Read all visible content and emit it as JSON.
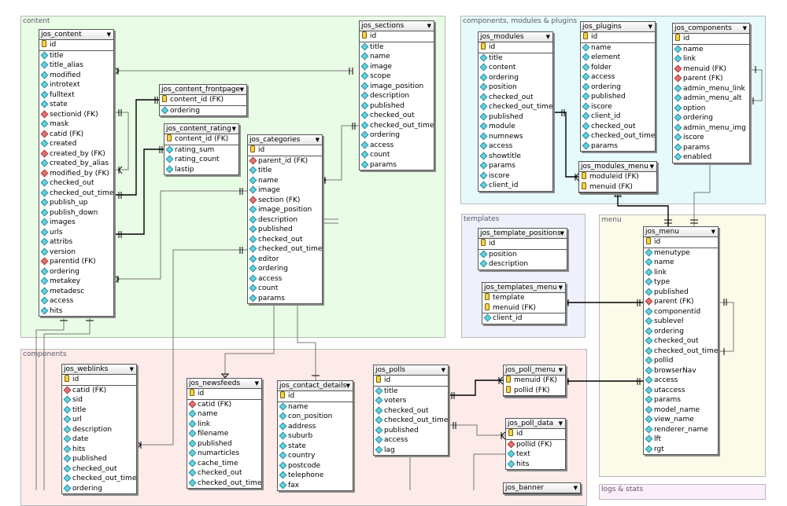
{
  "groups": [
    {
      "id": "content",
      "label": "content",
      "color": "#e9fce6"
    },
    {
      "id": "cmp",
      "label": "components, modules & plugins",
      "color": "#e6fafc"
    },
    {
      "id": "templates",
      "label": "templates",
      "color": "#eef0fc"
    },
    {
      "id": "menu",
      "label": "menu",
      "color": "#fcfbe9"
    },
    {
      "id": "components",
      "label": "components",
      "color": "#fdebea"
    },
    {
      "id": "logs",
      "label": "logs & stats",
      "color": "#fdeefc"
    }
  ],
  "tables": [
    {
      "id": "jos_content",
      "name": "jos_content",
      "fields": [
        [
          "id",
          "pk"
        ],
        [
          "title",
          "col"
        ],
        [
          "title_alias",
          "col"
        ],
        [
          "modified",
          "col"
        ],
        [
          "introtext",
          "col"
        ],
        [
          "fulltext",
          "col"
        ],
        [
          "state",
          "col"
        ],
        [
          "sectionid (FK)",
          "fk"
        ],
        [
          "mask",
          "col"
        ],
        [
          "catid (FK)",
          "fk"
        ],
        [
          "created",
          "col"
        ],
        [
          "created_by (FK)",
          "fk"
        ],
        [
          "created_by_alias",
          "col"
        ],
        [
          "modified_by (FK)",
          "fk"
        ],
        [
          "checked_out",
          "col"
        ],
        [
          "checked_out_time",
          "col"
        ],
        [
          "publish_up",
          "col"
        ],
        [
          "publish_down",
          "col"
        ],
        [
          "images",
          "col"
        ],
        [
          "urls",
          "col"
        ],
        [
          "attribs",
          "col"
        ],
        [
          "version",
          "col"
        ],
        [
          "parentid (FK)",
          "fk"
        ],
        [
          "ordering",
          "col"
        ],
        [
          "metakey",
          "col"
        ],
        [
          "metadesc",
          "col"
        ],
        [
          "access",
          "col"
        ],
        [
          "hits",
          "col"
        ]
      ]
    },
    {
      "id": "jos_content_frontpage",
      "name": "jos_content_frontpage",
      "fields": [
        [
          "content_id (FK)",
          "pk"
        ],
        [
          "ordering",
          "col"
        ]
      ]
    },
    {
      "id": "jos_content_rating",
      "name": "jos_content_rating",
      "fields": [
        [
          "content_id (FK)",
          "pk"
        ],
        [
          "rating_sum",
          "col"
        ],
        [
          "rating_count",
          "col"
        ],
        [
          "lastip",
          "col"
        ]
      ]
    },
    {
      "id": "jos_categories",
      "name": "jos_categories",
      "fields": [
        [
          "id",
          "pk"
        ],
        [
          "parent_id (FK)",
          "fk"
        ],
        [
          "title",
          "col"
        ],
        [
          "name",
          "col"
        ],
        [
          "image",
          "col"
        ],
        [
          "section (FK)",
          "fk"
        ],
        [
          "image_position",
          "col"
        ],
        [
          "description",
          "col"
        ],
        [
          "published",
          "col"
        ],
        [
          "checked_out",
          "col"
        ],
        [
          "checked_out_time",
          "col"
        ],
        [
          "editor",
          "col"
        ],
        [
          "ordering",
          "col"
        ],
        [
          "access",
          "col"
        ],
        [
          "count",
          "col"
        ],
        [
          "params",
          "col"
        ]
      ]
    },
    {
      "id": "jos_sections",
      "name": "jos_sections",
      "fields": [
        [
          "id",
          "pk"
        ],
        [
          "title",
          "col"
        ],
        [
          "name",
          "col"
        ],
        [
          "image",
          "col"
        ],
        [
          "scope",
          "col"
        ],
        [
          "image_position",
          "col"
        ],
        [
          "description",
          "col"
        ],
        [
          "published",
          "col"
        ],
        [
          "checked_out",
          "col"
        ],
        [
          "checked_out_time",
          "col"
        ],
        [
          "ordering",
          "col"
        ],
        [
          "access",
          "col"
        ],
        [
          "count",
          "col"
        ],
        [
          "params",
          "col"
        ]
      ]
    },
    {
      "id": "jos_modules",
      "name": "jos_modules",
      "fields": [
        [
          "id",
          "pk"
        ],
        [
          "title",
          "col"
        ],
        [
          "content",
          "col"
        ],
        [
          "ordering",
          "col"
        ],
        [
          "position",
          "col"
        ],
        [
          "checked_out",
          "col"
        ],
        [
          "checked_out_time",
          "col"
        ],
        [
          "published",
          "col"
        ],
        [
          "module",
          "col"
        ],
        [
          "numnews",
          "col"
        ],
        [
          "access",
          "col"
        ],
        [
          "showtitle",
          "col"
        ],
        [
          "params",
          "col"
        ],
        [
          "iscore",
          "col"
        ],
        [
          "client_id",
          "col"
        ]
      ]
    },
    {
      "id": "jos_plugins",
      "name": "jos_plugins",
      "fields": [
        [
          "id",
          "pk"
        ],
        [
          "name",
          "col"
        ],
        [
          "element",
          "col"
        ],
        [
          "folder",
          "col"
        ],
        [
          "access",
          "col"
        ],
        [
          "ordering",
          "col"
        ],
        [
          "published",
          "col"
        ],
        [
          "iscore",
          "col"
        ],
        [
          "client_id",
          "col"
        ],
        [
          "checked_out",
          "col"
        ],
        [
          "checked_out_time",
          "col"
        ],
        [
          "params",
          "col"
        ]
      ]
    },
    {
      "id": "jos_modules_menu",
      "name": "jos_modules_menu",
      "fields": [
        [
          "moduleid (FK)",
          "pk"
        ],
        [
          "menuid (FK)",
          "pk"
        ]
      ]
    },
    {
      "id": "jos_components",
      "name": "jos_components",
      "fields": [
        [
          "id",
          "pk"
        ],
        [
          "name",
          "col"
        ],
        [
          "link",
          "col"
        ],
        [
          "menuid (FK)",
          "fk"
        ],
        [
          "parent (FK)",
          "fk"
        ],
        [
          "admin_menu_link",
          "col"
        ],
        [
          "admin_menu_alt",
          "col"
        ],
        [
          "option",
          "col"
        ],
        [
          "ordering",
          "col"
        ],
        [
          "admin_menu_img",
          "col"
        ],
        [
          "iscore",
          "col"
        ],
        [
          "params",
          "col"
        ],
        [
          "enabled",
          "col"
        ]
      ]
    },
    {
      "id": "jos_template_positions",
      "name": "jos_template_positions",
      "fields": [
        [
          "id",
          "pk"
        ],
        [
          "position",
          "col"
        ],
        [
          "description",
          "col"
        ]
      ]
    },
    {
      "id": "jos_templates_menu",
      "name": "jos_templates_menu",
      "fields": [
        [
          "template",
          "pk"
        ],
        [
          "menuid (FK)",
          "pk"
        ],
        [
          "client_id",
          "col"
        ]
      ]
    },
    {
      "id": "jos_menu",
      "name": "jos_menu",
      "fields": [
        [
          "id",
          "pk"
        ],
        [
          "menutype",
          "col"
        ],
        [
          "name",
          "col"
        ],
        [
          "link",
          "col"
        ],
        [
          "type",
          "col"
        ],
        [
          "published",
          "col"
        ],
        [
          "parent (FK)",
          "fk"
        ],
        [
          "componentid",
          "col"
        ],
        [
          "sublevel",
          "col"
        ],
        [
          "ordering",
          "col"
        ],
        [
          "checked_out",
          "col"
        ],
        [
          "checked_out_time",
          "col"
        ],
        [
          "pollid",
          "col"
        ],
        [
          "browserNav",
          "col"
        ],
        [
          "access",
          "col"
        ],
        [
          "utaccess",
          "col"
        ],
        [
          "params",
          "col"
        ],
        [
          "model_name",
          "col"
        ],
        [
          "view_name",
          "col"
        ],
        [
          "renderer_name",
          "col"
        ],
        [
          "lft",
          "col"
        ],
        [
          "rgt",
          "col"
        ]
      ]
    },
    {
      "id": "jos_weblinks",
      "name": "jos_weblinks",
      "fields": [
        [
          "id",
          "pk"
        ],
        [
          "catid (FK)",
          "fk"
        ],
        [
          "sid",
          "col"
        ],
        [
          "title",
          "col"
        ],
        [
          "url",
          "col"
        ],
        [
          "description",
          "col"
        ],
        [
          "date",
          "col"
        ],
        [
          "hits",
          "col"
        ],
        [
          "published",
          "col"
        ],
        [
          "checked_out",
          "col"
        ],
        [
          "checked_out_time",
          "col"
        ],
        [
          "ordering",
          "col"
        ]
      ]
    },
    {
      "id": "jos_newsfeeds",
      "name": "jos_newsfeeds",
      "fields": [
        [
          "id",
          "pk"
        ],
        [
          "catid (FK)",
          "fk"
        ],
        [
          "name",
          "col"
        ],
        [
          "link",
          "col"
        ],
        [
          "filename",
          "col"
        ],
        [
          "published",
          "col"
        ],
        [
          "numarticles",
          "col"
        ],
        [
          "cache_time",
          "col"
        ],
        [
          "checked_out",
          "col"
        ],
        [
          "checked_out_time",
          "col"
        ]
      ]
    },
    {
      "id": "jos_contact_details",
      "name": "jos_contact_details",
      "fields": [
        [
          "id",
          "pk"
        ],
        [
          "name",
          "col"
        ],
        [
          "con_position",
          "col"
        ],
        [
          "address",
          "col"
        ],
        [
          "suburb",
          "col"
        ],
        [
          "state",
          "col"
        ],
        [
          "country",
          "col"
        ],
        [
          "postcode",
          "col"
        ],
        [
          "telephone",
          "col"
        ],
        [
          "fax",
          "col"
        ]
      ]
    },
    {
      "id": "jos_polls",
      "name": "jos_polls",
      "fields": [
        [
          "id",
          "pk"
        ],
        [
          "title",
          "col"
        ],
        [
          "voters",
          "col"
        ],
        [
          "checked_out",
          "col"
        ],
        [
          "checked_out_time",
          "col"
        ],
        [
          "published",
          "col"
        ],
        [
          "access",
          "col"
        ],
        [
          "lag",
          "col"
        ]
      ]
    },
    {
      "id": "jos_poll_menu",
      "name": "jos_poll_menu",
      "fields": [
        [
          "menuid (FK)",
          "pk"
        ],
        [
          "pollid (FK)",
          "pk"
        ]
      ]
    },
    {
      "id": "jos_poll_data",
      "name": "jos_poll_data",
      "fields": [
        [
          "id",
          "pk"
        ],
        [
          "pollid (FK)",
          "fk"
        ],
        [
          "text",
          "col"
        ],
        [
          "hits",
          "col"
        ]
      ]
    },
    {
      "id": "jos_banner",
      "name": "jos_banner",
      "fields": []
    }
  ],
  "icons": {
    "pk": "key-icon",
    "fk": "foreign-key-diamond-icon",
    "col": "column-diamond-icon"
  },
  "colors": {
    "pk": "#f2d34a",
    "fk": "#e87070",
    "col": "#5fd4e0"
  }
}
